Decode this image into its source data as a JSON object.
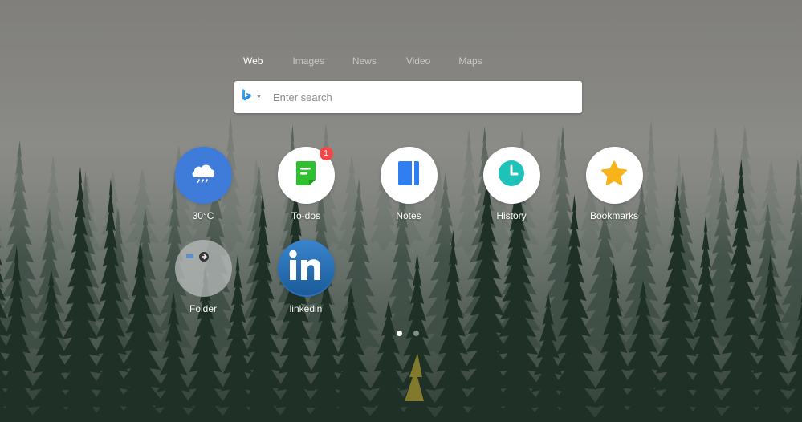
{
  "search": {
    "tabs": [
      {
        "label": "Web",
        "active": true
      },
      {
        "label": "Images",
        "active": false
      },
      {
        "label": "News",
        "active": false
      },
      {
        "label": "Video",
        "active": false
      },
      {
        "label": "Maps",
        "active": false
      }
    ],
    "placeholder": "Enter search",
    "engine_icon": "bing-icon"
  },
  "tiles": [
    {
      "label": "30°C",
      "icon": "weather-cloud-rain-icon",
      "color": "#3f7cd9"
    },
    {
      "label": "To-dos",
      "icon": "todo-note-icon",
      "color": "#2ec02e",
      "badge": "1"
    },
    {
      "label": "Notes",
      "icon": "notebook-icon",
      "color": "#2f7ef2"
    },
    {
      "label": "History",
      "icon": "clock-icon",
      "color": "#1fc2b8"
    },
    {
      "label": "Bookmarks",
      "icon": "star-icon",
      "color": "#f7b319"
    },
    {
      "label": "Folder",
      "icon": "folder-icon"
    },
    {
      "label": "linkedin",
      "icon": "linkedin-icon",
      "color": "#2a71b7"
    }
  ],
  "pagination": {
    "pages": 2,
    "current": 1
  }
}
